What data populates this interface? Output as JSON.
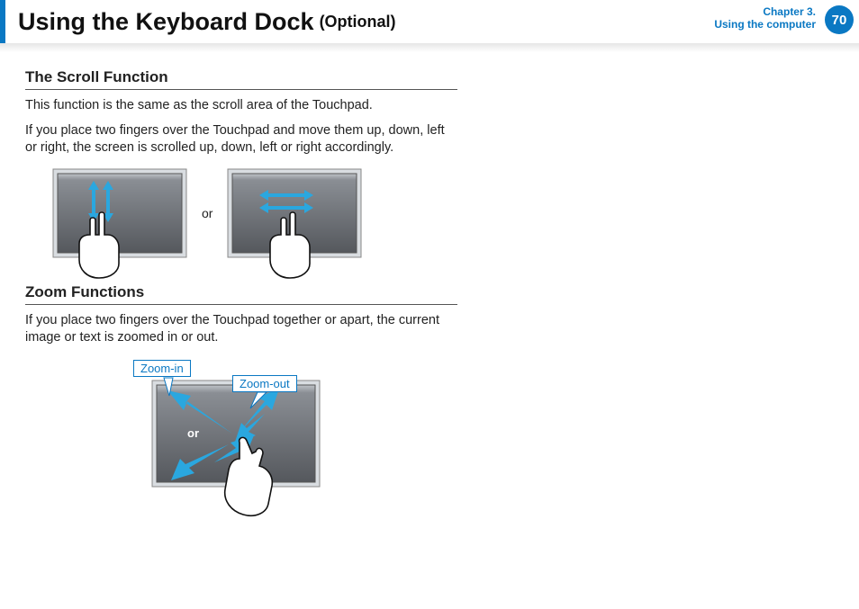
{
  "header": {
    "title": "Using the Keyboard Dock",
    "optional": "(Optional)",
    "chapter_line1": "Chapter 3.",
    "chapter_line2": "Using the computer",
    "page_number": "70"
  },
  "section1": {
    "title": "The Scroll Function",
    "p1": "This function is the same as the scroll area of the Touchpad.",
    "p2": "If you place two fingers over the Touchpad and move them up, down, left or right, the screen is scrolled up, down, left or right accordingly.",
    "or": "or"
  },
  "section2": {
    "title": "Zoom Functions",
    "p1": "If you place two fingers over the Touchpad together or apart, the current image or text is zoomed in or out.",
    "zoom_in_label": "Zoom-in",
    "zoom_out_label": "Zoom-out",
    "or": "or"
  }
}
